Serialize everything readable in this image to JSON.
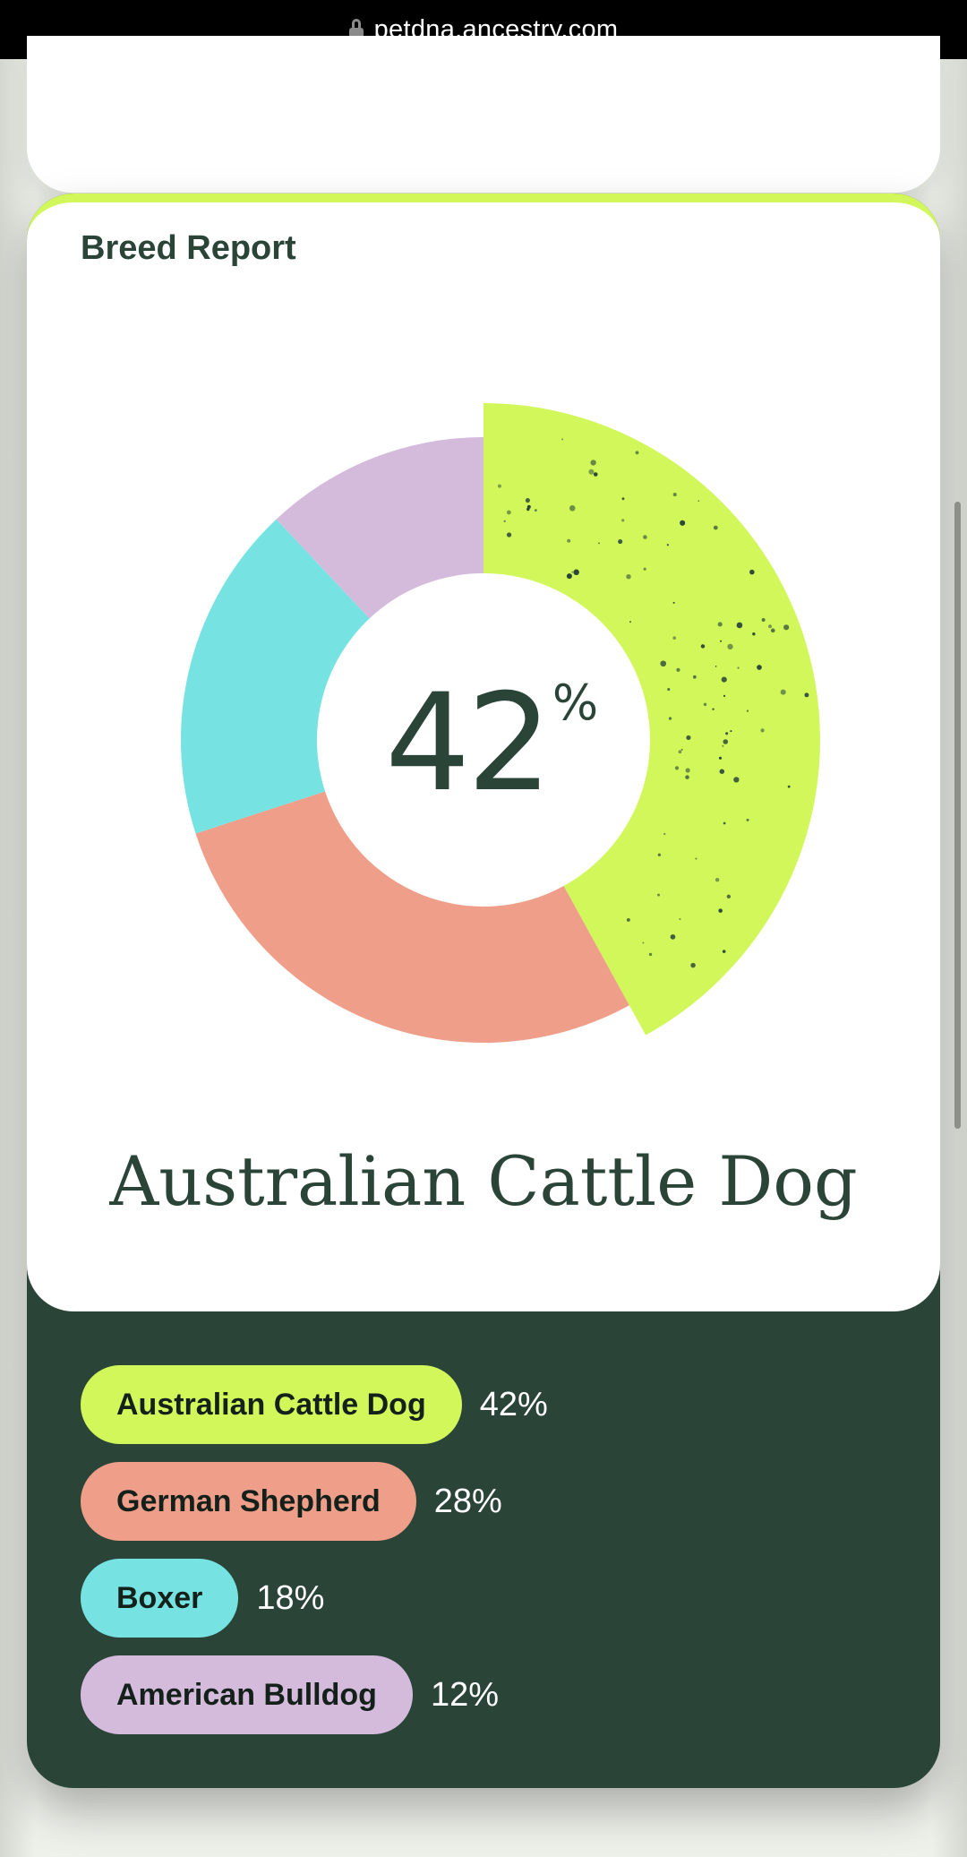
{
  "browser": {
    "url": "petdna.ancestry.com",
    "lock_icon": "lock-icon"
  },
  "report": {
    "title": "Breed Report",
    "center_value": "42",
    "center_unit": "%",
    "breed_name": "Australian Cattle Dog"
  },
  "colors": {
    "accent": "#d1f75b",
    "dark_green": "#2a4438",
    "salmon": "#ee9e89",
    "cyan": "#76e3e2",
    "lavender": "#d4bbdc"
  },
  "legend": [
    {
      "label": "Australian Cattle Dog",
      "pct": "42%",
      "color": "#d1f75b"
    },
    {
      "label": "German Shepherd",
      "pct": "28%",
      "color": "#ee9e89"
    },
    {
      "label": "Boxer",
      "pct": "18%",
      "color": "#76e3e2"
    },
    {
      "label": "American Bulldog",
      "pct": "12%",
      "color": "#d4bbdc"
    }
  ],
  "chart_data": {
    "type": "pie",
    "categories": [
      "Australian Cattle Dog",
      "German Shepherd",
      "Boxer",
      "American Bulldog"
    ],
    "values": [
      42,
      28,
      18,
      12
    ],
    "colors": [
      "#d1f75b",
      "#ee9e89",
      "#76e3e2",
      "#d4bbdc"
    ],
    "highlighted": "Australian Cattle Dog",
    "donut": true
  }
}
